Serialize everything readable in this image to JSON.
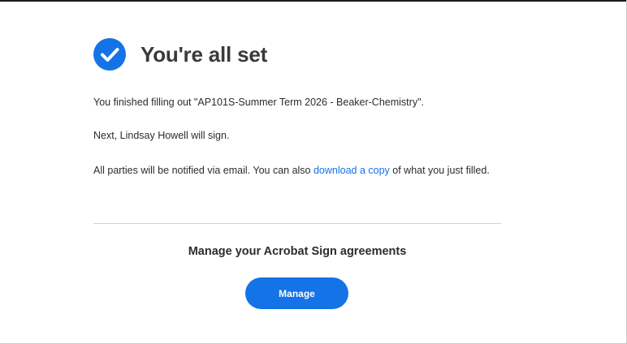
{
  "header": {
    "title": "You're all set",
    "icon": "checkmark-circle-icon",
    "accent": "#1473e6"
  },
  "body": {
    "finished_text": "You finished filling out \"AP101S-Summer Term 2026 - Beaker-Chemistry\".",
    "next_text": "Next, Lindsay Howell will sign.",
    "notify_prefix": "All parties will be notified via email. You can also ",
    "download_link": "download a copy",
    "notify_suffix": " of what you just filled."
  },
  "manage": {
    "heading": "Manage your Acrobat Sign agreements",
    "button_label": "Manage"
  }
}
